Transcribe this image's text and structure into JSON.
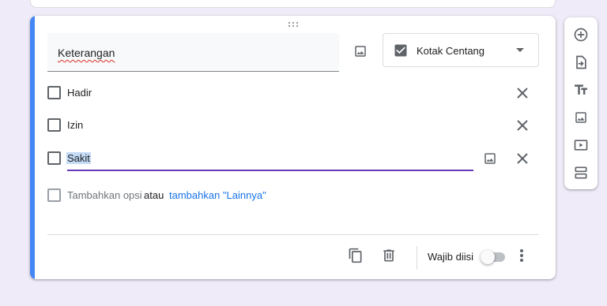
{
  "question": {
    "title": "Keterangan",
    "type_label": "Kotak Centang",
    "options": [
      {
        "label": "Hadir"
      },
      {
        "label": "Izin"
      },
      {
        "label": "Sakit"
      }
    ],
    "add_option_label": "Tambahkan opsi",
    "add_option_or": "atau",
    "add_other_label": "tambahkan \"Lainnya\"",
    "required_label": "Wajib diisi",
    "required": false
  },
  "colors": {
    "accent": "#4285f4",
    "active_underline": "#673ab7",
    "link": "#1a73e8",
    "background": "#f0ebf8"
  },
  "sidebar": {
    "items": [
      {
        "icon": "add-question-icon"
      },
      {
        "icon": "import-questions-icon"
      },
      {
        "icon": "add-title-icon"
      },
      {
        "icon": "add-image-icon"
      },
      {
        "icon": "add-video-icon"
      },
      {
        "icon": "add-section-icon"
      }
    ]
  }
}
